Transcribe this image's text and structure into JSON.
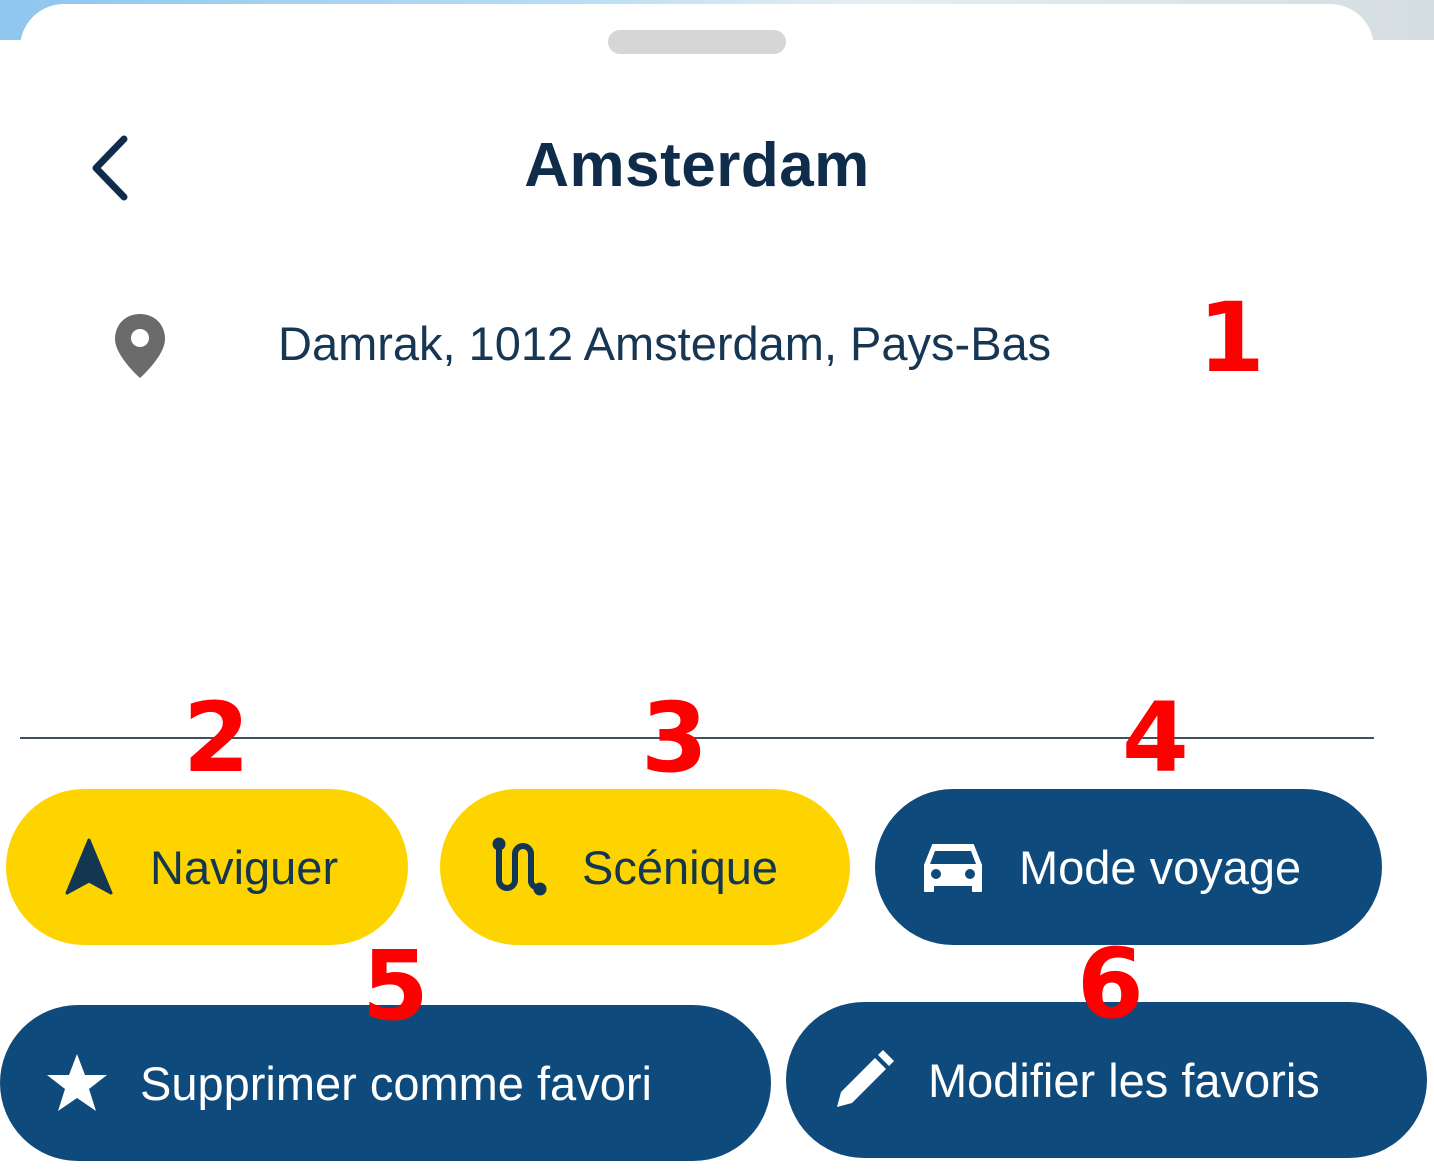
{
  "header": {
    "title": "Amsterdam",
    "back_icon": "chevron-left-icon"
  },
  "location": {
    "icon": "map-pin-icon",
    "address": "Damrak, 1012 Amsterdam, Pays-Bas"
  },
  "actions": {
    "navigate": {
      "label": "Naviguer",
      "icon": "navigation-arrow-icon"
    },
    "scenic": {
      "label": "Scénique",
      "icon": "scenic-route-icon"
    },
    "trip_mode": {
      "label": "Mode voyage",
      "icon": "car-icon"
    },
    "remove_favorite": {
      "label": "Supprimer comme favori",
      "icon": "star-icon"
    },
    "edit_favorites": {
      "label": "Modifier les favoris",
      "icon": "pencil-icon"
    }
  },
  "annotations": [
    "1",
    "2",
    "3",
    "4",
    "5",
    "6"
  ],
  "colors": {
    "primary_yellow": "#fed400",
    "primary_blue": "#0f4a7d",
    "text_dark": "#0f2d4a",
    "annotation_red": "#ff0000"
  }
}
